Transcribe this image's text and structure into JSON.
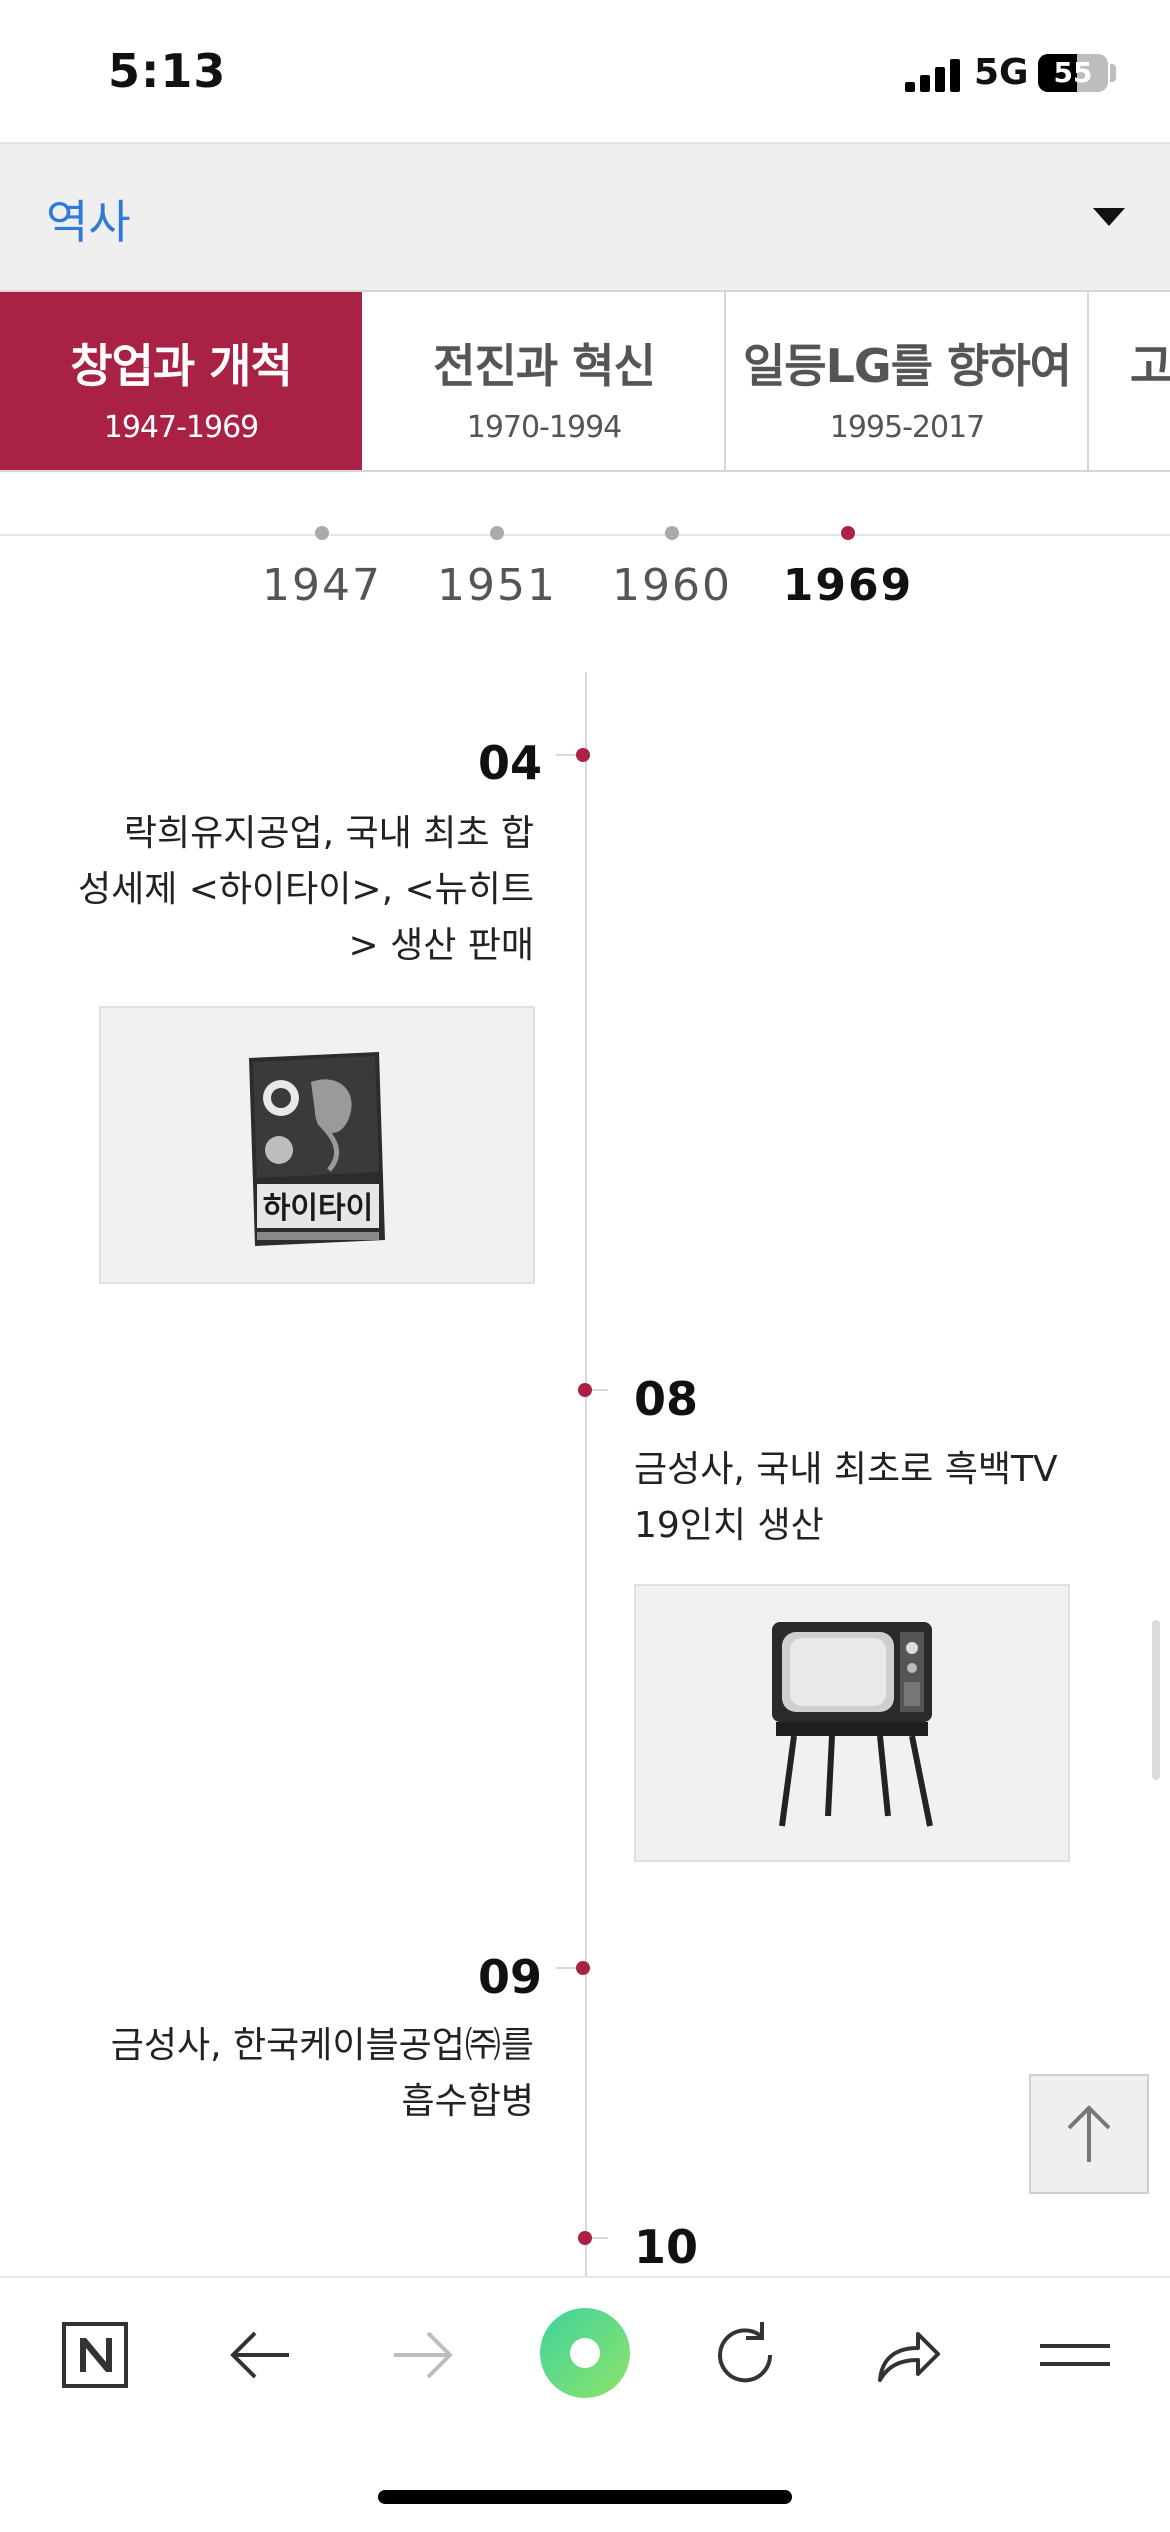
{
  "status_bar": {
    "time": "5:13",
    "network": "5G",
    "battery": "55",
    "battery_level_percent": 55
  },
  "section": {
    "title": "역사"
  },
  "era_tabs": [
    {
      "label": "창업과 개척",
      "years": "1947-1969",
      "active": true
    },
    {
      "label": "전진과 혁신",
      "years": "1970-1994",
      "active": false
    },
    {
      "label": "일등LG를 향하여",
      "years": "1995-2017",
      "active": false
    },
    {
      "label": "고",
      "years": "",
      "active": false
    }
  ],
  "years": [
    {
      "label": "1947",
      "active": false
    },
    {
      "label": "1951",
      "active": false
    },
    {
      "label": "1960",
      "active": false
    },
    {
      "label": "1969",
      "active": true
    }
  ],
  "events": [
    {
      "month": "04",
      "side": "left",
      "lines": [
        "락희유지공업, 국내 최초 합",
        "성세제 <하이타이>, <뉴히트",
        "> 생산 판매"
      ],
      "image": "detergent-box"
    },
    {
      "month": "08",
      "side": "right",
      "lines": [
        "금성사, 국내 최초로 흑백TV",
        "19인치 생산"
      ],
      "image": "black-white-tv"
    },
    {
      "month": "09",
      "side": "left",
      "lines": [
        "금성사, 한국케이블공업㈜를",
        "흡수합병"
      ]
    },
    {
      "month": "10",
      "side": "right",
      "lines": []
    }
  ],
  "image_text": {
    "detergent_brand": "하이타이"
  },
  "icons": {
    "top": "arrow-up-icon",
    "dropdown": "caret-down-icon",
    "nav": [
      "naver-n-icon",
      "back-arrow-icon",
      "forward-arrow-icon",
      "green-circle-home-icon",
      "refresh-icon",
      "share-icon",
      "menu-icon"
    ]
  },
  "colors": {
    "accent": "#a92144",
    "link": "#2f7ad9",
    "green": "#43d68a"
  }
}
